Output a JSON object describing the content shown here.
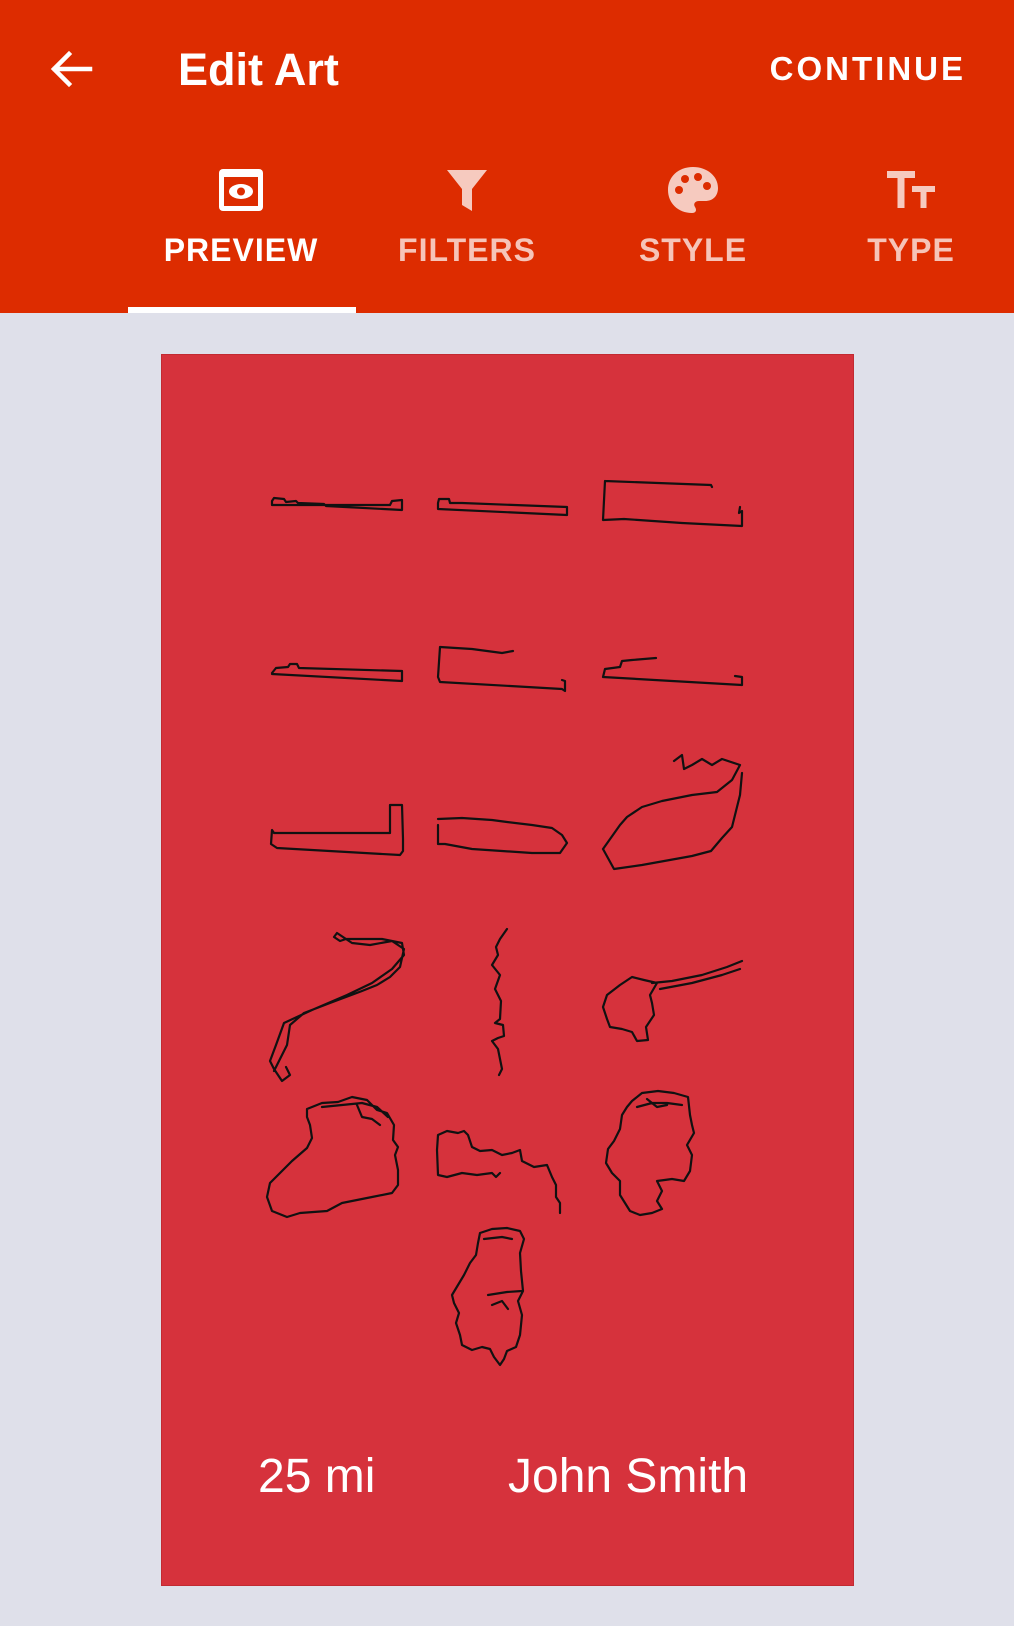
{
  "header": {
    "title": "Edit Art",
    "continue_label": "CONTINUE",
    "back_icon": "arrow-left-icon"
  },
  "tabs": [
    {
      "label": "PREVIEW",
      "icon": "eye-icon",
      "active": true
    },
    {
      "label": "FILTERS",
      "icon": "filter-icon",
      "active": false
    },
    {
      "label": "STYLE",
      "icon": "palette-icon",
      "active": false
    },
    {
      "label": "TYPE",
      "icon": "text-size-icon",
      "active": false
    }
  ],
  "poster": {
    "distance": "25 mi",
    "name": "John Smith"
  },
  "colors": {
    "appbar": "#dd2c00",
    "background": "#dfe0ea",
    "poster": "#d6323c",
    "route_stroke": "#111111",
    "text": "#ffffff"
  }
}
